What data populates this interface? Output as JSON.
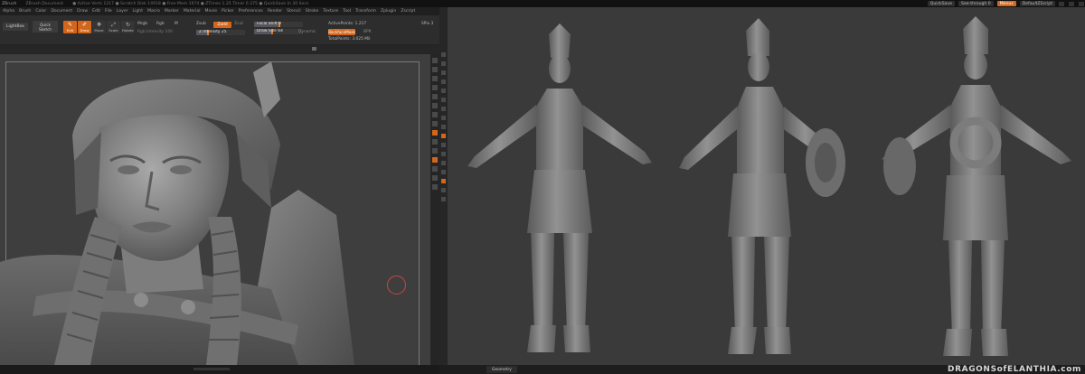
{
  "app": {
    "title": "ZBrush",
    "document_title": "ZBrush Document",
    "title_stats": "● Active Verts 1217 ● Scratch Disk 14918 ● Free Mem 1974 ● ZTimes 1.25 Timer 0.375 ● QuickSave In 30 Secs",
    "quicksave_label": "QuickSave",
    "seethrough_label": "See-through 0",
    "menus_label": "Menus",
    "default_zscript_label": "DefaultZScript"
  },
  "menubar": {
    "items": [
      "Alpha",
      "Brush",
      "Color",
      "Document",
      "Draw",
      "Edit",
      "File",
      "Layer",
      "Light",
      "Macro",
      "Marker",
      "Material",
      "Movie",
      "Picker",
      "Preferences",
      "Render",
      "Stencil",
      "Stroke",
      "Texture",
      "Tool",
      "Transform",
      "Zplugin",
      "Zscript"
    ]
  },
  "toolbar": {
    "lightbox": "LightBox",
    "quick_sketch_1": "Quick",
    "quick_sketch_2": "Sketch",
    "tools": [
      {
        "name": "edit",
        "label": "Edit",
        "glyph": "✎",
        "active": true
      },
      {
        "name": "draw",
        "label": "Draw",
        "glyph": "✐",
        "active": true
      },
      {
        "name": "move",
        "label": "Move",
        "glyph": "✥",
        "active": false
      },
      {
        "name": "scale",
        "label": "Scale",
        "glyph": "⤢",
        "active": false
      },
      {
        "name": "rotate",
        "label": "Rotate",
        "glyph": "↻",
        "active": false
      }
    ],
    "mrgb": "Mrgb",
    "rgb": "Rgb",
    "m": "M",
    "zadd": "Zadd",
    "zsub": "Zsub",
    "zcut": "Zcut",
    "rgb_button": "Rgb",
    "rgb_intensity": "Rgb Intensity 100",
    "z_intensity": "Z Intensity 25",
    "focal_shift": "Focal Shift 0",
    "draw_size": "Draw Size 64",
    "dynamic": "Dynamic",
    "active_points": "ActivePoints: 1.217",
    "total_points": "TotalPoints: 3.025 Mil",
    "backface_mask": "BackfaceMask",
    "bpr": "BPR",
    "spix": "SPix 3"
  },
  "viewport_left": {
    "frame_visible": true
  },
  "viewport_right": {
    "tab_label": "Geometry"
  },
  "watermark": "DRAGONSofELANTHIA.com",
  "colors": {
    "accent": "#d4661b",
    "ui_dark": "#1b1b1b",
    "viewport_bg": "#3e3e3e",
    "cursor_ring": "#cc4444"
  }
}
